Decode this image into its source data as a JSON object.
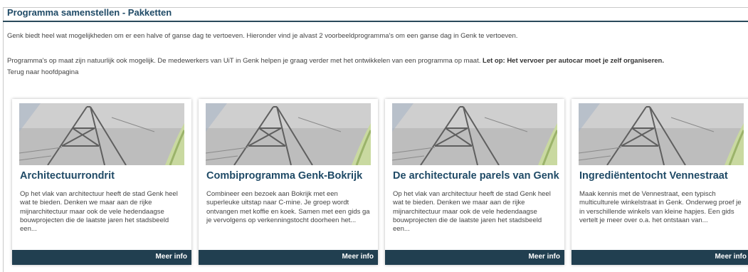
{
  "header": {
    "title": "Programma samenstellen - Pakketten"
  },
  "intro": {
    "line1": "Genk biedt heel wat mogelijkheden om er een halve of ganse dag te vertoeven. Hieronder vind je alvast 2 voorbeeldprogramma's om een ganse dag in Genk te vertoeven.",
    "line2_text": "Programma's op maat zijn natuurlijk ook mogelijk. De medewerkers van UiT in Genk helpen je graag verder met het ontwikkelen van een programma op maat. ",
    "line2_bold": "Let op: Het vervoer per autocar moet je zelf organiseren.",
    "back_link": "Terug naar hoofdpagina"
  },
  "colors": {
    "title": "#1f4a66",
    "footer_bar": "#213f50",
    "footer_text": "#ffffff"
  },
  "cards": [
    {
      "image_icon": "mine-headframe-photo",
      "title": "Architectuurrondrit",
      "description": "Op het vlak van architectuur heeft de stad Genk heel wat te bieden. Denken we maar aan de rijke mijnarchitectuur maar ook de vele hedendaagse bouwprojecten die de laatste jaren het stadsbeeld een...",
      "more_label": "Meer info"
    },
    {
      "image_icon": "mine-headframe-photo",
      "title": "Combiprogramma Genk-Bokrijk",
      "description": "Combineer een bezoek aan Bokrijk met een superleuke uitstap naar C-mine. Je groep wordt ontvangen met koffie en koek. Samen met een gids ga je vervolgens op verkenningstocht doorheen het...",
      "more_label": "Meer info"
    },
    {
      "image_icon": "mine-headframe-photo",
      "title": "De architecturale parels van Genk",
      "description": "Op het vlak van architectuur heeft de stad Genk heel wat te bieden. Denken we maar aan de rijke mijnarchitectuur maar ook de vele hedendaagse bouwprojecten die de laatste jaren het stadsbeeld een...",
      "more_label": "Meer info"
    },
    {
      "image_icon": "mine-headframe-photo",
      "title": "Ingrediëntentocht Vennestraat",
      "description": "Maak kennis met de Vennestraat, een typisch multiculturele winkelstraat in Genk. Onderweg proef je in verschillende winkels van kleine hapjes. Een gids vertelt je meer over o.a. het ontstaan van...",
      "more_label": "Meer info"
    }
  ]
}
